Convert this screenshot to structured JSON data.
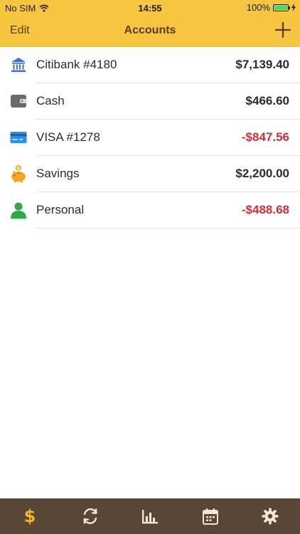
{
  "status": {
    "carrier": "No SIM",
    "time": "14:55",
    "battery": "100%"
  },
  "nav": {
    "edit_label": "Edit",
    "title": "Accounts"
  },
  "accounts": [
    {
      "name": "Citibank #4180",
      "amount": "$7,139.40",
      "icon": "bank-icon"
    },
    {
      "name": "Cash",
      "amount": "$466.60",
      "icon": "wallet-icon"
    },
    {
      "name": "VISA #1278",
      "amount": "-$847.56",
      "icon": "credit-card-icon"
    },
    {
      "name": "Savings",
      "amount": "$2,200.00",
      "icon": "piggy-bank-icon"
    },
    {
      "name": "Personal",
      "amount": "-$488.68",
      "icon": "person-icon"
    }
  ],
  "tabs": [
    {
      "icon": "dollar-icon",
      "active": true
    },
    {
      "icon": "sync-icon",
      "active": false
    },
    {
      "icon": "bar-chart-icon",
      "active": false
    },
    {
      "icon": "calendar-icon",
      "active": false
    },
    {
      "icon": "gear-icon",
      "active": false
    }
  ],
  "colors": {
    "header": "#f6c542",
    "header_text": "#5b3a16",
    "negative": "#c8323c",
    "tabbar": "#5a4634",
    "tab_active": "#f6b627",
    "tab_inactive": "#efe6da"
  }
}
